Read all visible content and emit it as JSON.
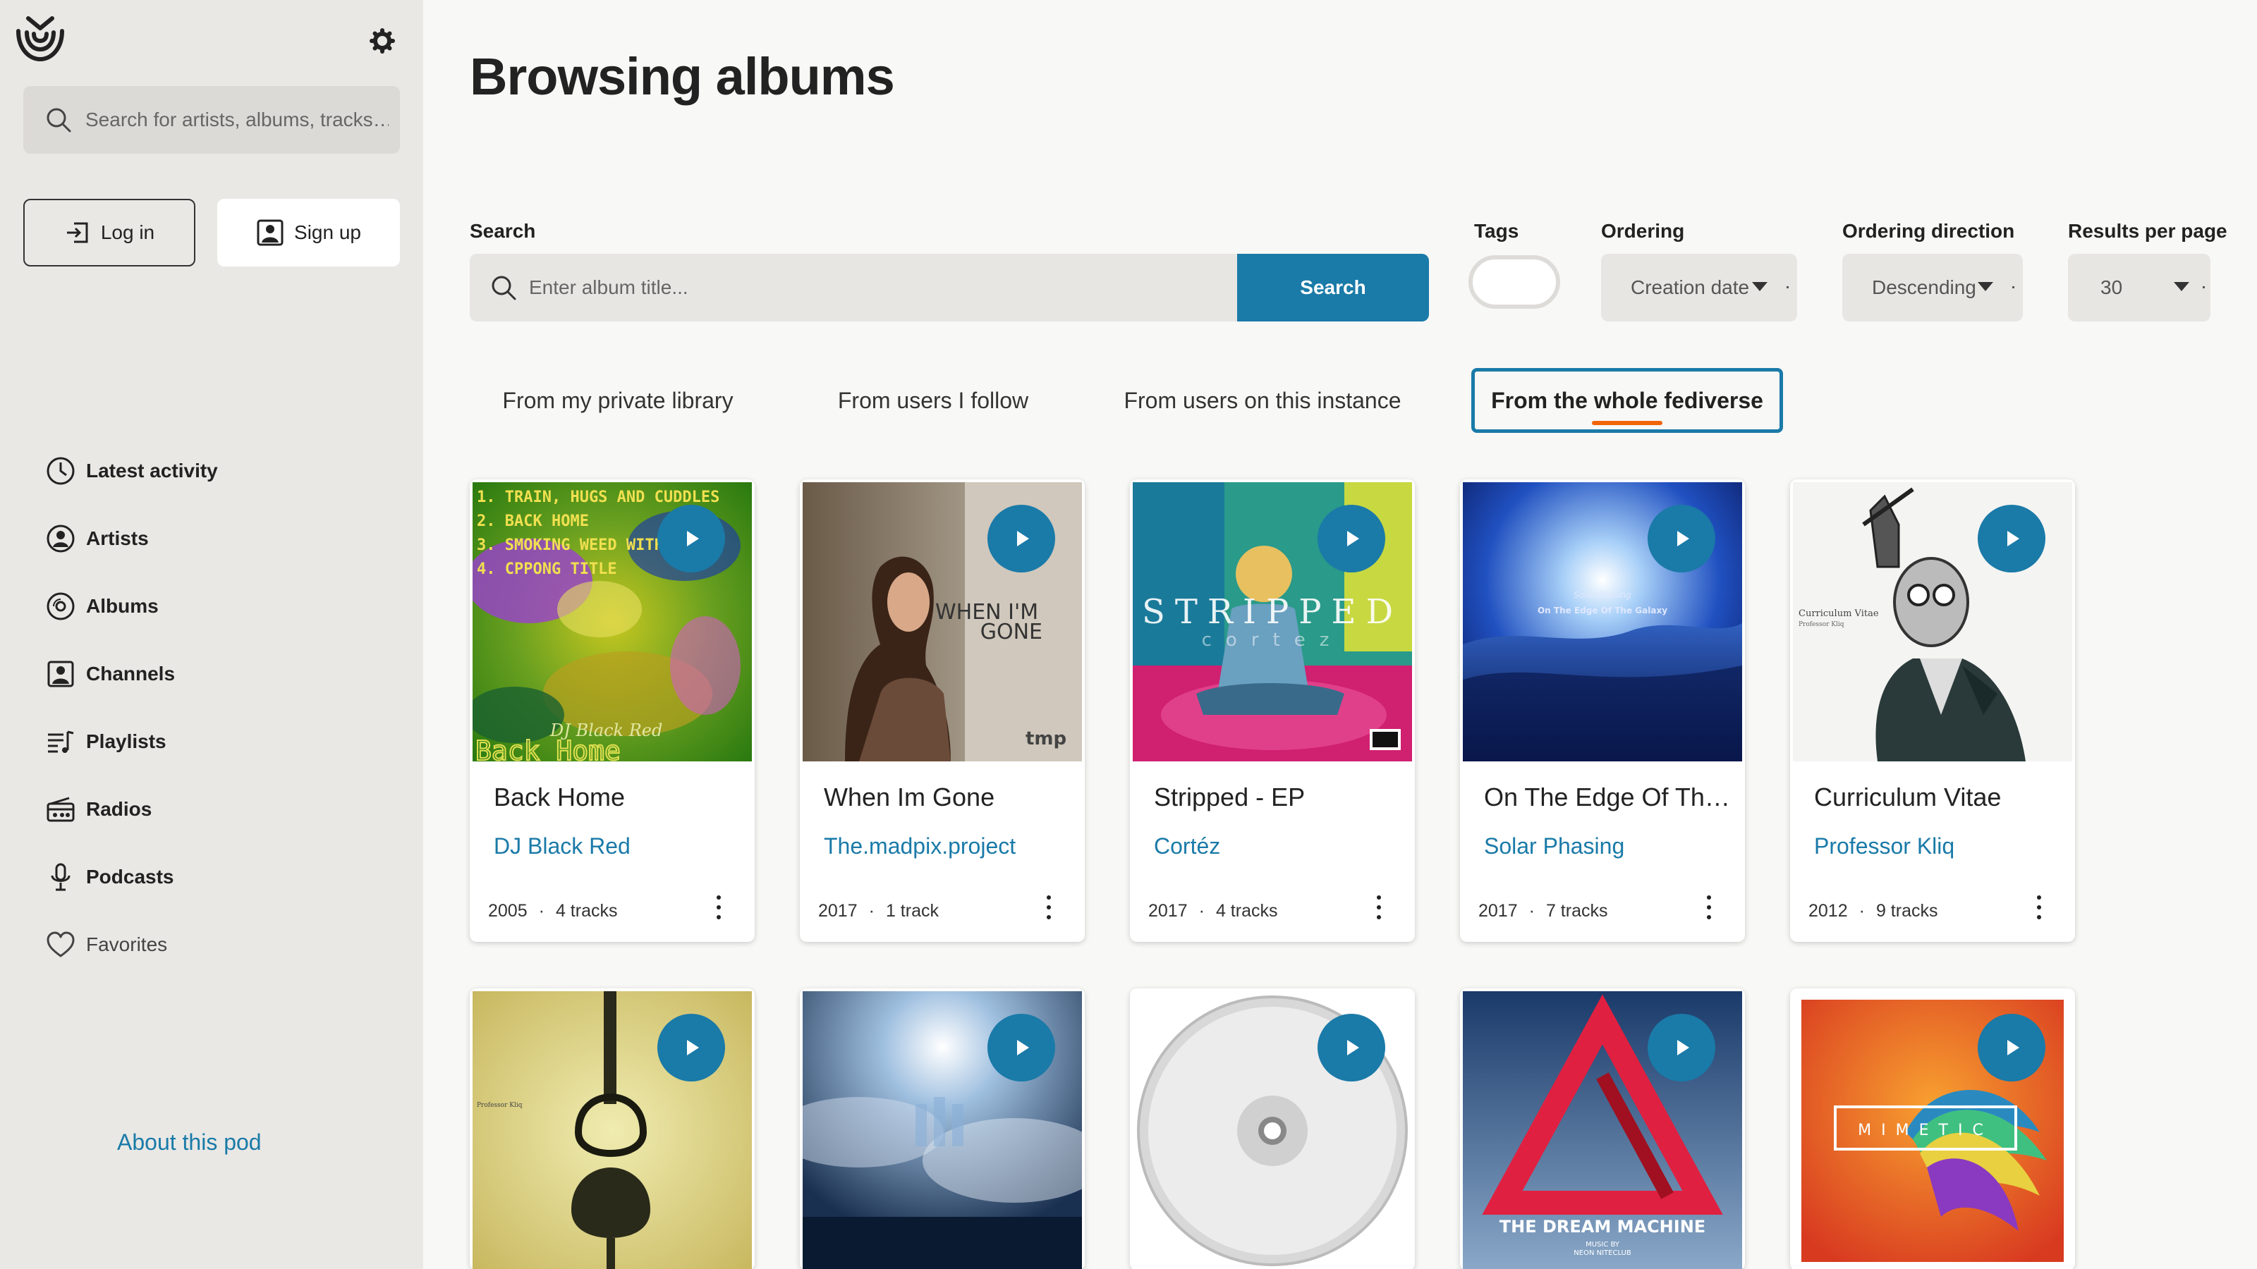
{
  "sidebar": {
    "search_placeholder": "Search for artists, albums, tracks…",
    "login_label": "Log in",
    "signup_label": "Sign up",
    "nav": [
      {
        "label": "Latest activity",
        "icon": "clock-icon"
      },
      {
        "label": "Artists",
        "icon": "user-circle-icon"
      },
      {
        "label": "Albums",
        "icon": "disc-icon"
      },
      {
        "label": "Channels",
        "icon": "user-square-icon"
      },
      {
        "label": "Playlists",
        "icon": "playlist-icon"
      },
      {
        "label": "Radios",
        "icon": "radio-icon"
      },
      {
        "label": "Podcasts",
        "icon": "microphone-icon"
      },
      {
        "label": "Favorites",
        "icon": "heart-icon"
      }
    ],
    "about_label": "About this pod"
  },
  "main": {
    "title": "Browsing albums",
    "search_label": "Search",
    "search_placeholder": "Enter album title...",
    "search_button": "Search",
    "tags_label": "Tags",
    "ordering_label": "Ordering",
    "ordering_value": "Creation date",
    "direction_label": "Ordering direction",
    "direction_value": "Descending",
    "results_label": "Results per page",
    "results_value": "30",
    "tabs": [
      {
        "label": "From my private library"
      },
      {
        "label": "From users I follow"
      },
      {
        "label": "From users on this instance"
      },
      {
        "label": "From the whole fediverse",
        "active": true
      }
    ]
  },
  "albums": [
    {
      "title": "Back Home",
      "artist": "DJ Black Red",
      "year": "2005",
      "tracks": "4 tracks",
      "cover_text": [
        "1. TRAIN, HUGS AND CUDDLES",
        "2. BACK HOME",
        "3. SMOKING WEED WITH",
        "4. CPPONG TITLE",
        "DJ Black Red",
        "Back Home"
      ]
    },
    {
      "title": "When Im Gone",
      "artist": "The.madpix.project",
      "year": "2017",
      "tracks": "1 track",
      "cover_text": [
        "WHEN I'M",
        "GONE",
        "tmp"
      ]
    },
    {
      "title": "Stripped - EP",
      "artist": "Cortéz",
      "year": "2017",
      "tracks": "4 tracks",
      "cover_text": [
        "STRIPPED",
        "cortez"
      ]
    },
    {
      "title": "On The Edge Of The Galaxy",
      "artist": "Solar Phasing",
      "year": "2017",
      "tracks": "7 tracks",
      "cover_text": [
        "Solar Phasing",
        "On The Edge Of The Galaxy"
      ]
    },
    {
      "title": "Curriculum Vitae",
      "artist": "Professor Kliq",
      "year": "2012",
      "tracks": "9 tracks",
      "cover_text": [
        "Curriculum Vitae",
        "Professor Kliq"
      ]
    },
    {
      "title": "",
      "cover_text": [
        "Professor Kliq"
      ]
    },
    {
      "title": "",
      "cover_text": []
    },
    {
      "title": "",
      "cover_text": []
    },
    {
      "title": "",
      "cover_text": [
        "THE DREAM MACHINE",
        "MUSIC BY",
        "NEON NITECLUB"
      ]
    },
    {
      "title": "",
      "cover_text": [
        "MIMETIC"
      ]
    }
  ],
  "colors": {
    "accent": "#1a7aa8",
    "sidebar_bg": "#e9e8e5",
    "tab_underline": "#f2640a"
  }
}
